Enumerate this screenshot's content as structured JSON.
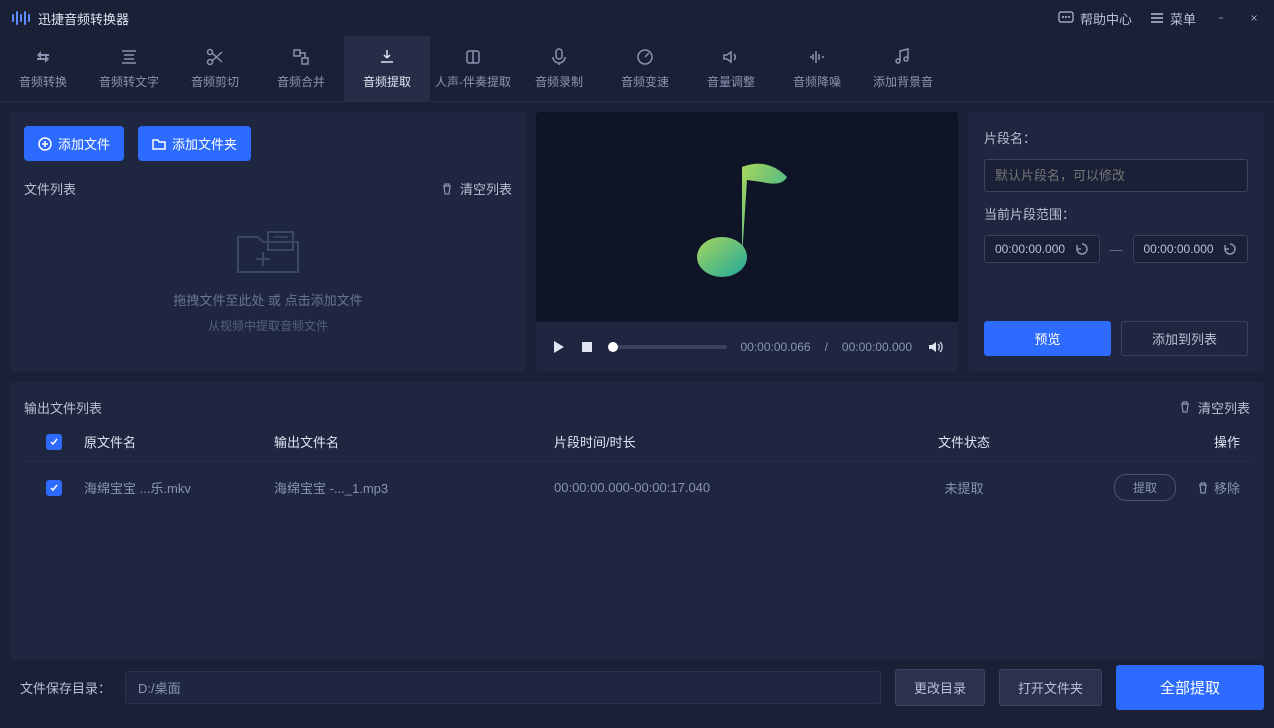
{
  "titlebar": {
    "app_name": "迅捷音频转换器",
    "help": "帮助中心",
    "menu": "菜单"
  },
  "nav": [
    {
      "label": "音频转换"
    },
    {
      "label": "音频转文字"
    },
    {
      "label": "音频剪切"
    },
    {
      "label": "音频合并"
    },
    {
      "label": "音频提取"
    },
    {
      "label": "人声-伴奏提取"
    },
    {
      "label": "音频录制"
    },
    {
      "label": "音频变速"
    },
    {
      "label": "音量调整"
    },
    {
      "label": "音频降噪"
    },
    {
      "label": "添加背景音"
    }
  ],
  "active_nav": 4,
  "left": {
    "add_file": "添加文件",
    "add_folder": "添加文件夹",
    "list_title": "文件列表",
    "clear": "清空列表",
    "drop_hint": "拖拽文件至此处 或 点击添加文件",
    "drop_sub": "从视频中提取音频文件"
  },
  "player": {
    "cur": "00:00:00.066",
    "total": "00:00:00.000"
  },
  "right": {
    "seg_name_label": "片段名：",
    "seg_placeholder": "默认片段名，可以修改",
    "range_label": "当前片段范围：",
    "start": "00:00:00.000",
    "end": "00:00:00.000",
    "preview": "预览",
    "add_to_list": "添加到列表"
  },
  "output": {
    "title": "输出文件列表",
    "clear": "清空列表",
    "headers": {
      "src": "原文件名",
      "out": "输出文件名",
      "seg": "片段时间/时长",
      "status": "文件状态",
      "action": "操作"
    },
    "rows": [
      {
        "src": "海绵宝宝 ...乐.mkv",
        "out": "海绵宝宝 -..._1.mp3",
        "seg": "00:00:00.000-00:00:17.040",
        "status": "未提取",
        "extract": "提取",
        "remove": "移除"
      }
    ]
  },
  "footer": {
    "out_label": "文件保存目录：",
    "out_path": "D:/桌面",
    "change_dir": "更改目录",
    "open_folder": "打开文件夹",
    "extract_all": "全部提取"
  }
}
